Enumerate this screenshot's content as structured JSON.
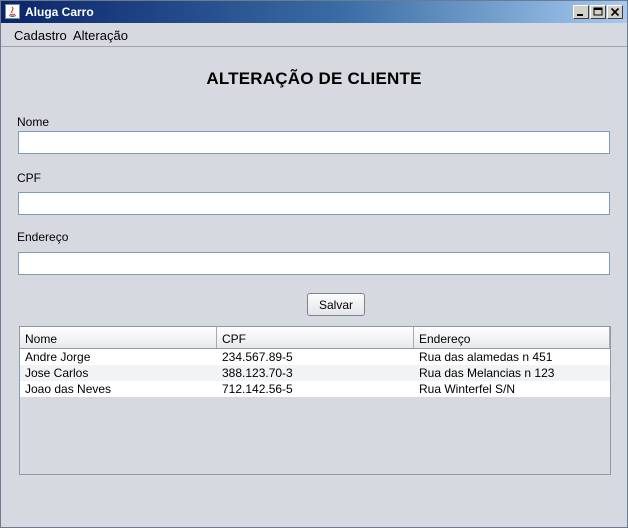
{
  "window": {
    "title": "Aluga Carro",
    "icon": "java-icon",
    "controls": [
      "minimize-icon",
      "maximize-icon",
      "close-icon"
    ]
  },
  "menu": {
    "items": [
      {
        "label": "Cadastro"
      },
      {
        "label": "Alteração"
      }
    ]
  },
  "form": {
    "title": "ALTERAÇÃO DE CLIENTE",
    "fields": [
      {
        "label": "Nome",
        "value": ""
      },
      {
        "label": "CPF",
        "value": ""
      },
      {
        "label": "Endereço",
        "value": ""
      }
    ],
    "save_label": "Salvar"
  },
  "table": {
    "columns": [
      "Nome",
      "CPF",
      "Endereço"
    ],
    "rows": [
      [
        "Andre Jorge",
        "234.567.89-5",
        "Rua das alamedas n 451"
      ],
      [
        "Jose Carlos",
        "388.123.70-3",
        "Rua das Melancias n 123"
      ],
      [
        "Joao das Neves",
        "712.142.56-5",
        "Rua Winterfel S/N"
      ]
    ]
  },
  "colors": {
    "titlebar_start": "#0a246a",
    "titlebar_end": "#a6caf0",
    "window_bg": "#d6d9df"
  }
}
